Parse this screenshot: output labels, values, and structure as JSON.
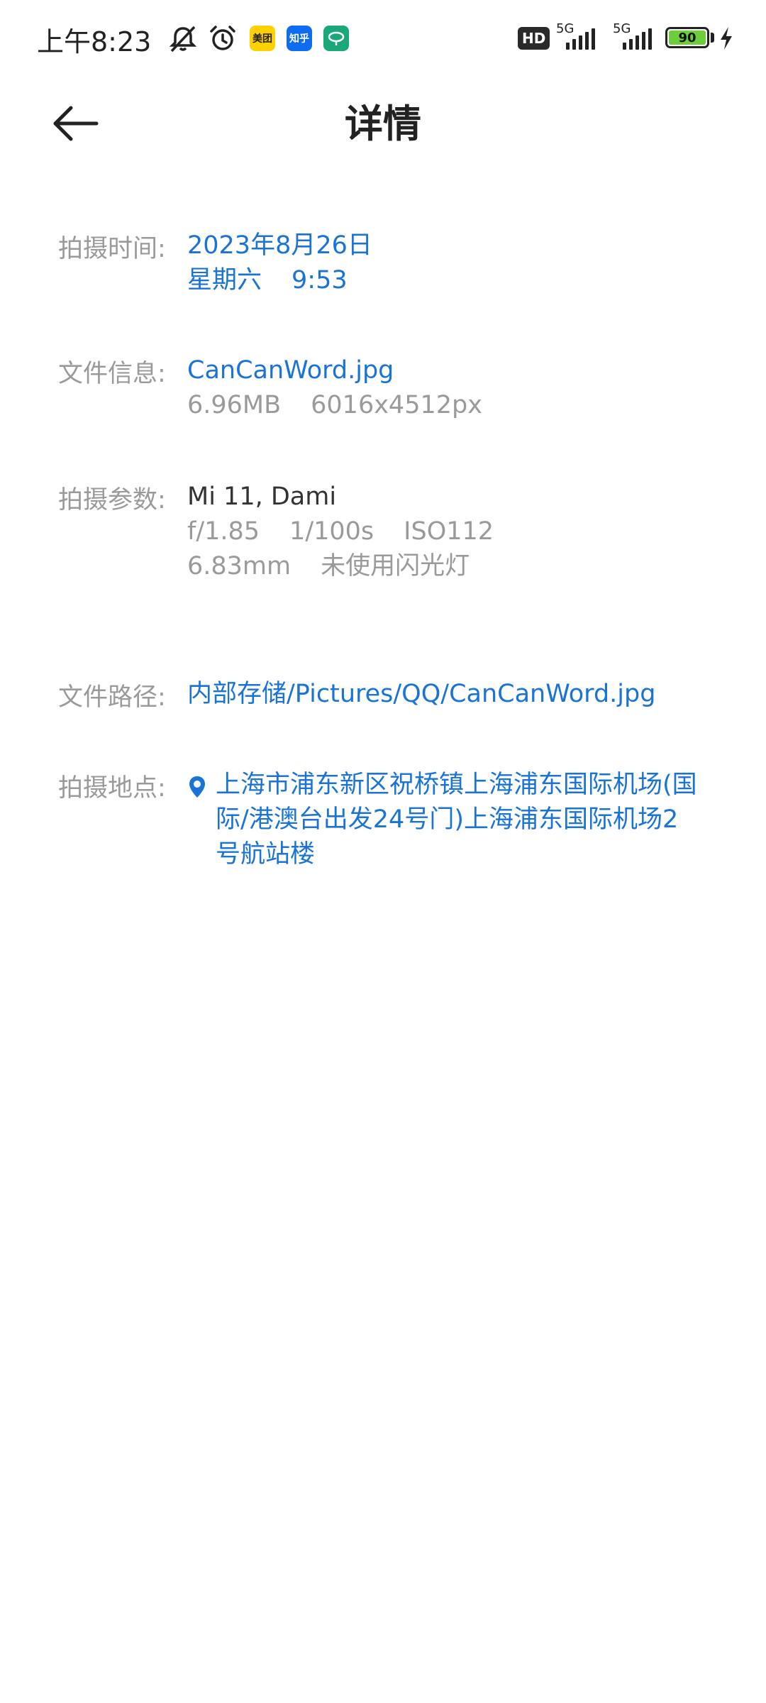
{
  "status_bar": {
    "time": "上午8:23",
    "apps": [
      "美团",
      "知乎"
    ],
    "hd_label": "HD",
    "net1": "5G",
    "net2": "5G",
    "battery": "90",
    "colors": {
      "battery_fill": "#6ccf3a",
      "meituan": "#ffd100",
      "zhihu": "#0f6bf0",
      "app3": "#1aa77a"
    }
  },
  "header": {
    "title": "详情",
    "back_icon": "arrow-left-icon"
  },
  "details": {
    "time": {
      "label": "拍摄时间:",
      "date": "2023年8月26日",
      "weekday": "星期六",
      "clock": "9:53"
    },
    "file": {
      "label": "文件信息:",
      "name": "CanCanWord.jpg",
      "size": "6.96MB",
      "resolution": "6016x4512px"
    },
    "params": {
      "label": "拍摄参数:",
      "device": "Mi 11, Dami",
      "aperture": "f/1.85",
      "shutter": "1/100s",
      "iso": "ISO112",
      "focal": "6.83mm",
      "flash": "未使用闪光灯"
    },
    "path": {
      "label": "文件路径:",
      "value": "内部存储/Pictures/QQ/CanCanWord.jpg"
    },
    "location": {
      "label": "拍摄地点:",
      "icon": "location-pin-icon",
      "lines": [
        "上海市浦东新区祝桥镇上海浦东国际机场(国",
        "际/港澳台出发24号门)上海浦东国际机场2",
        "号航站楼"
      ]
    }
  },
  "theme": {
    "accent": "#1a73d6",
    "label_color": "#9a9a9a"
  }
}
